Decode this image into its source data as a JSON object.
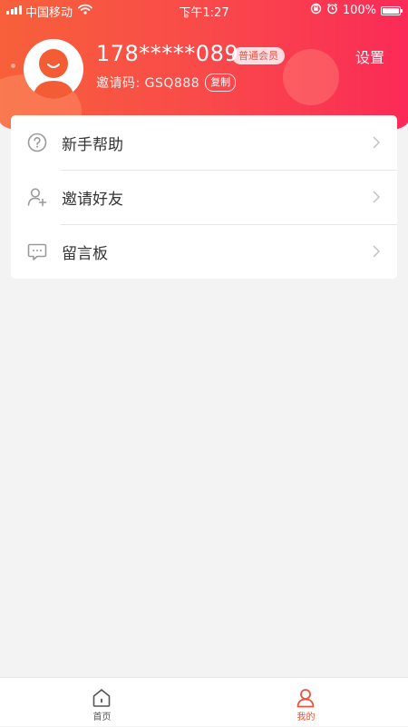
{
  "status_bar": {
    "carrier": "中国移动",
    "time": "下午1:27",
    "battery": "100%",
    "battery_level": 1.0
  },
  "profile": {
    "phone": "178*****089",
    "member_badge": "普通会员",
    "invite_code_line": "邀请码: GSQ888",
    "copy_label": "复制",
    "settings_label": "设置"
  },
  "menu": {
    "items": [
      {
        "label": "新手帮助",
        "icon": "question-circle-icon"
      },
      {
        "label": "邀请好友",
        "icon": "add-user-icon"
      },
      {
        "label": "留言板",
        "icon": "message-board-icon"
      }
    ]
  },
  "tabbar": {
    "tabs": [
      {
        "label": "首页",
        "icon": "home-icon",
        "active": false
      },
      {
        "label": "我的",
        "icon": "profile-icon",
        "active": true
      }
    ]
  },
  "colors": {
    "header_gradient_start": "#f7603a",
    "header_gradient_end": "#fb2a57",
    "accent": "#f0513a",
    "tab_inactive": "#555555",
    "icon_gray": "#9a9a9a"
  }
}
